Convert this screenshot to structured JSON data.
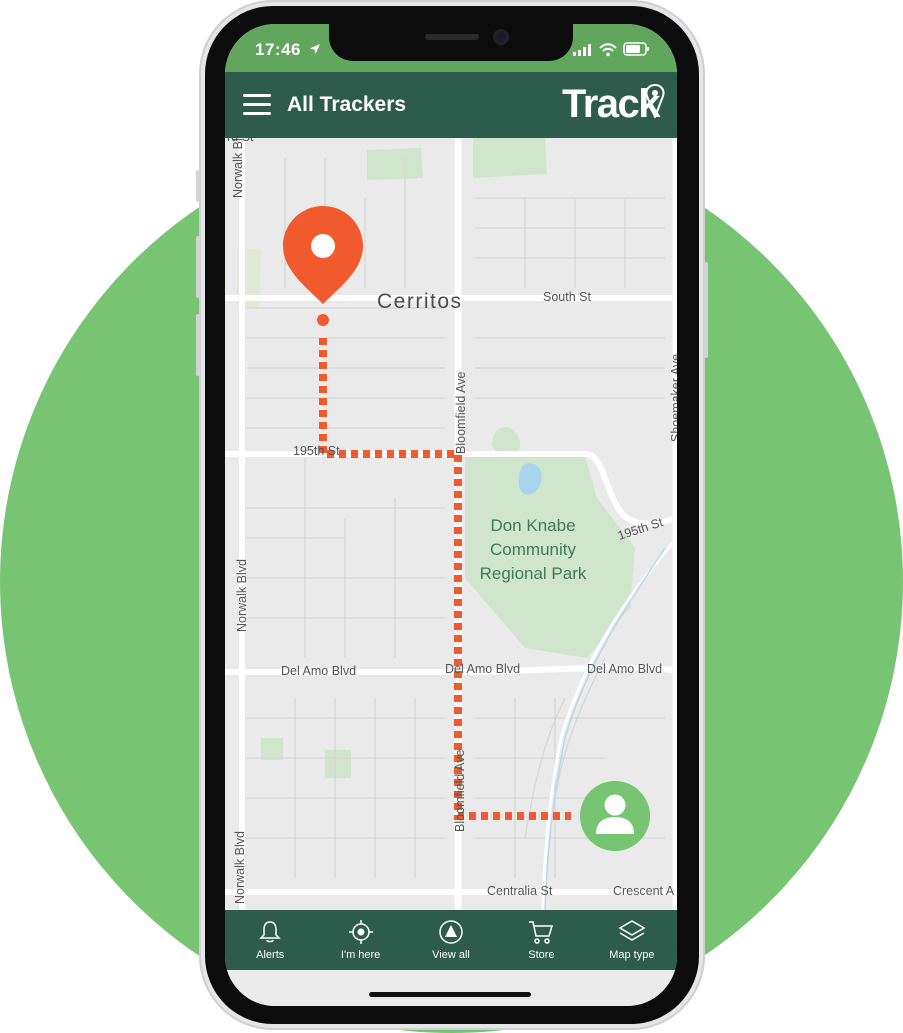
{
  "status_bar": {
    "time": "17:46"
  },
  "header": {
    "title": "All Trackers",
    "logo": "Track"
  },
  "map": {
    "city": "Cerritos",
    "park_name": "Don Knabe Community Regional Park",
    "streets": {
      "south_st": "South St",
      "bloomfield_ave_top": "Bloomfield Ave",
      "bloomfield_ave_bottom": "Bloomfield Ave",
      "shoemaker_ave": "Shoemaker Ave",
      "st_195th_left": "195th St",
      "st_195th_right": "195th St",
      "norwalk_blvd_top": "Norwalk Blvd",
      "norwalk_blvd_mid": "Norwalk Blvd",
      "norwalk_blvd_bottom": "Norwalk Blvd",
      "del_amo_left": "Del Amo Blvd",
      "del_amo_mid": "Del Amo Blvd",
      "del_amo_right": "Del Amo Blvd",
      "centralia_st": "Centralia St",
      "crescent_ave": "Crescent A",
      "top_partial": "rd St"
    },
    "route_color": "#f05a2d",
    "user_marker_color": "#77c573"
  },
  "bottom_nav": [
    {
      "label": "Alerts",
      "icon": "bell-icon"
    },
    {
      "label": "I'm here",
      "icon": "crosshair-icon"
    },
    {
      "label": "View all",
      "icon": "navigation-arrow-icon"
    },
    {
      "label": "Store",
      "icon": "cart-icon"
    },
    {
      "label": "Map type",
      "icon": "layers-icon"
    }
  ],
  "colors": {
    "brand_dark": "#2e5c4c",
    "brand_green": "#61a65c",
    "accent": "#f05a2d",
    "background_circle": "#77c573"
  }
}
